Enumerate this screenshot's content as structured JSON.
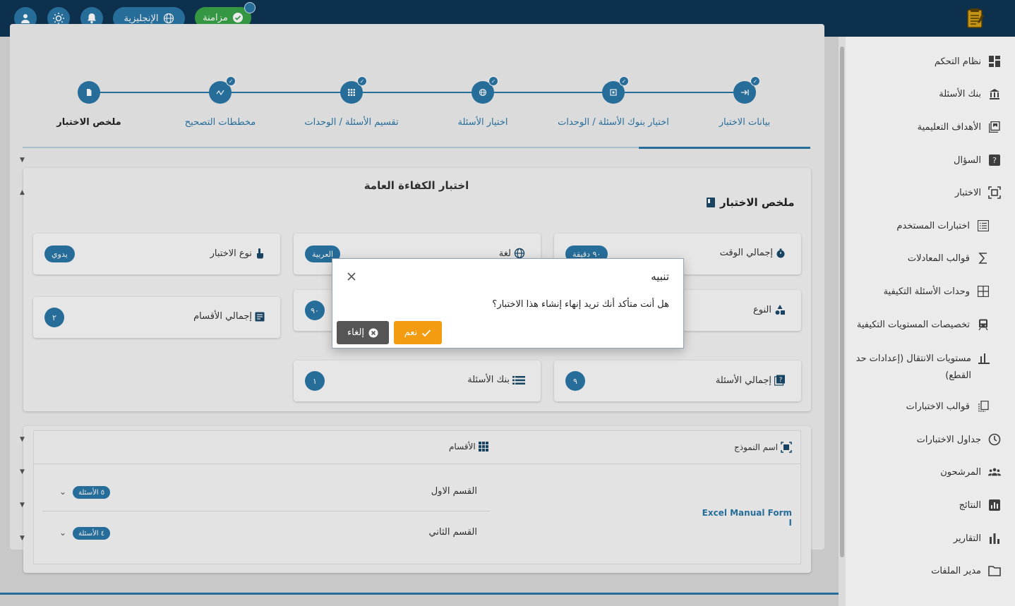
{
  "topbar": {
    "language_label": "الإنجليزية",
    "sync_label": "مزامنة"
  },
  "sidebar": {
    "items": [
      {
        "label": "نظام التحكم",
        "icon": "dashboard-icon"
      },
      {
        "label": "بنك الأسئلة",
        "icon": "bank-icon"
      },
      {
        "label": "الأهداف التعليمية",
        "icon": "library-icon"
      },
      {
        "label": "السؤال",
        "icon": "question-icon"
      },
      {
        "label": "الاختبار",
        "icon": "exam-icon"
      },
      {
        "label": "اختبارات المستخدم",
        "icon": "list-icon"
      },
      {
        "label": "قوالب المعادلات",
        "icon": "sigma-icon"
      },
      {
        "label": "وحدات الأسئلة التكيفية",
        "icon": "grid-icon"
      },
      {
        "label": "تخصيصات المستويات التكيفية",
        "icon": "train-icon"
      },
      {
        "label": "مستويات الانتقال (إعدادات حد القطع)",
        "icon": "bar-chart-icon"
      },
      {
        "label": "قوالب الاختبارات",
        "icon": "copy-icon"
      },
      {
        "label": "جداول الاختبارات",
        "icon": "clock-icon"
      },
      {
        "label": "المرشحون",
        "icon": "people-icon"
      },
      {
        "label": "النتائج",
        "icon": "chart-box-icon"
      },
      {
        "label": "التقارير",
        "icon": "reports-icon"
      },
      {
        "label": "مدير الملفات",
        "icon": "folder-icon"
      }
    ]
  },
  "stepper": {
    "steps": [
      {
        "label": "بيانات الاختبار",
        "icon": "arrow-icon"
      },
      {
        "label": "اختيار بنوك الأسئلة / الوحدات",
        "icon": "banks-icon"
      },
      {
        "label": "اختيار الأسئلة",
        "icon": "globe-icon"
      },
      {
        "label": "تقسيم الأسئلة / الوحدات",
        "icon": "grid-icon"
      },
      {
        "label": "مخططات التصحيح",
        "icon": "graph-icon"
      },
      {
        "label": "ملخص الاختبار",
        "icon": "doc-icon"
      }
    ]
  },
  "summary": {
    "heading": "ملخص الاختبار",
    "exam_title": "اختبار الكفاءة العامة",
    "cards": {
      "total_time": {
        "label": "إجمالي الوقت",
        "value": "٩٠ دقيقة"
      },
      "language": {
        "label": "لغة",
        "value": "العربية"
      },
      "exam_type": {
        "label": "نوع الاختبار",
        "value": "يدوي"
      },
      "type": {
        "label": "النوع",
        "value": ""
      },
      "middle_value": {
        "label": "",
        "value": "٩٠"
      },
      "total_sections": {
        "label": "إجمالي الأقسام",
        "value": "٢"
      },
      "total_questions": {
        "label": "إجمالي الأسئلة",
        "value": "٩"
      },
      "question_bank": {
        "label": "بنك الأسئلة",
        "value": "١"
      }
    }
  },
  "table": {
    "col_model": "اسم النموذج",
    "col_sections": "الأقسام",
    "model_name": "Excel Manual Form I",
    "sections": [
      {
        "name": "القسم الاول",
        "count": "٥ الأسئلة"
      },
      {
        "name": "القسم الثاني",
        "count": "٤ الأسئلة"
      }
    ]
  },
  "dialog": {
    "title": "تنبيه",
    "message": "هل أنت متأكد أنك تريد إنهاء إنشاء هذا الاختبار؟",
    "yes_label": "نعم",
    "cancel_label": "إلغاء"
  },
  "colors": {
    "topbar": "#0f3654",
    "primary": "#2b77a8",
    "sync": "#3aa44a",
    "warning": "#f39c12",
    "cancel": "#555555"
  }
}
